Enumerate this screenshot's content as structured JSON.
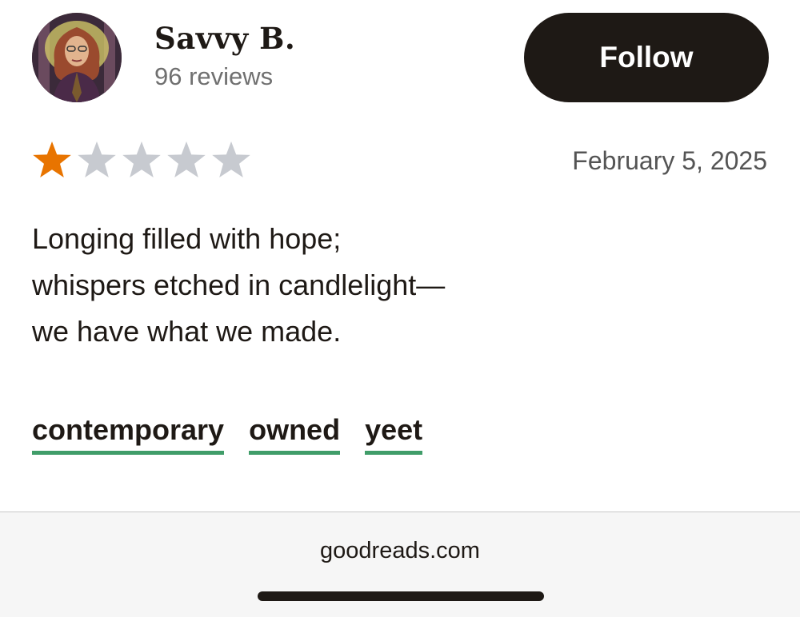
{
  "reviewer": {
    "name": "Savvy B.",
    "review_count": "96 reviews"
  },
  "follow_button": {
    "label": "Follow"
  },
  "rating": {
    "value": 1,
    "max": 5,
    "filled_color": "#e87400",
    "empty_color": "#c7cad0"
  },
  "review": {
    "date": "February 5, 2025",
    "lines": [
      "Longing filled with hope;",
      "whispers etched in candlelight—",
      "we have what we made."
    ]
  },
  "shelves": [
    "contemporary",
    "owned",
    "yeet"
  ],
  "footer": {
    "site": "goodreads.com"
  },
  "colors": {
    "text": "#1e1915",
    "shelf_underline": "#409d69",
    "button_bg": "#1e1915"
  }
}
